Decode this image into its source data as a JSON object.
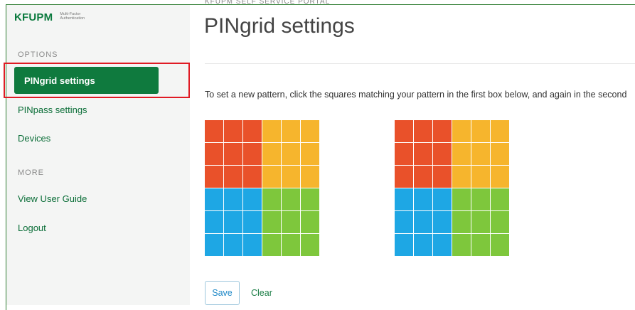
{
  "brand": {
    "logo": "KFUPM",
    "subtitle": "Multi-Factor Authentication"
  },
  "sidebar": {
    "options_label": "OPTIONS",
    "items": [
      {
        "label": "PINgrid settings",
        "active": true
      },
      {
        "label": "PINpass settings"
      },
      {
        "label": "Devices"
      }
    ],
    "more_label": "MORE",
    "more_items": [
      {
        "label": "View User Guide"
      },
      {
        "label": "Logout"
      }
    ]
  },
  "header": {
    "breadcrumb": "KFUPM SELF SERVICE PORTAL",
    "title": "PINgrid settings"
  },
  "main": {
    "instruction": "To set a new pattern, click the squares matching your pattern in the first box below, and again in the second",
    "grid_colors": {
      "top_left": "#e9512a",
      "top_right": "#f6b52d",
      "bottom_left": "#1ea7e4",
      "bottom_right": "#7ec73c"
    }
  },
  "actions": {
    "save_label": "Save",
    "clear_label": "Clear"
  }
}
